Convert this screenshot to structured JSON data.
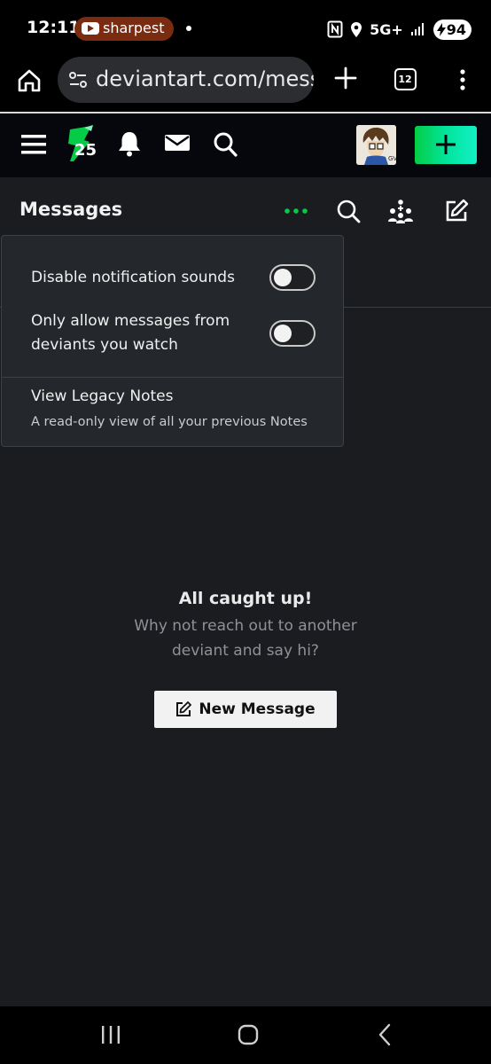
{
  "status_bar": {
    "time": "12:11",
    "notification_app": "sharpest",
    "network": "5G+",
    "battery": "94"
  },
  "browser": {
    "url": "deviantart.com/messa",
    "tab_count": "12"
  },
  "site_header": {
    "logo_badge": "25"
  },
  "messages": {
    "title": "Messages"
  },
  "popover": {
    "disable_sounds_label": "Disable notification sounds",
    "only_watch_label_line1": "Only allow messages from",
    "only_watch_label_line2": "deviants you watch",
    "legacy_title": "View Legacy Notes",
    "legacy_subtitle": "A read-only view of all your previous Notes",
    "disable_sounds_on": false,
    "only_watch_on": false
  },
  "empty_state": {
    "title": "All caught up!",
    "subtitle": "Why not reach out to another deviant and say hi?",
    "button_label": "New Message"
  },
  "colors": {
    "accent_green": "#05cc47",
    "background": "#1a1c1f",
    "popover_bg": "#24272b"
  }
}
